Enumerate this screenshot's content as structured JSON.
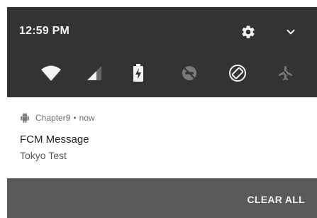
{
  "status_bar": {
    "time": "12:59 PM",
    "settings_icon": "gear-icon",
    "expand_icon": "chevron-down-icon"
  },
  "quick_settings": [
    {
      "id": "wifi",
      "icon": "wifi-icon",
      "state": "on"
    },
    {
      "id": "cellular",
      "icon": "signal-icon",
      "state": "partial"
    },
    {
      "id": "battery",
      "icon": "battery-charging-icon",
      "state": "charging"
    },
    {
      "id": "do-not-disturb",
      "icon": "dnd-off-icon",
      "state": "off"
    },
    {
      "id": "auto-rotate",
      "icon": "rotate-icon",
      "state": "on"
    },
    {
      "id": "airplane-mode",
      "icon": "airplane-icon",
      "state": "off"
    }
  ],
  "notification": {
    "app_icon": "android-icon",
    "app_name": "Chapter9",
    "separator": "•",
    "time": "now",
    "title": "FCM Message",
    "text": "Tokyo Test"
  },
  "footer": {
    "clear_all_label": "CLEAR ALL"
  },
  "colors": {
    "header_bg": "#333333",
    "footer_bg": "#5a5a5a",
    "icon_active": "#f2f2f2",
    "icon_inactive": "#7a7a7a"
  }
}
